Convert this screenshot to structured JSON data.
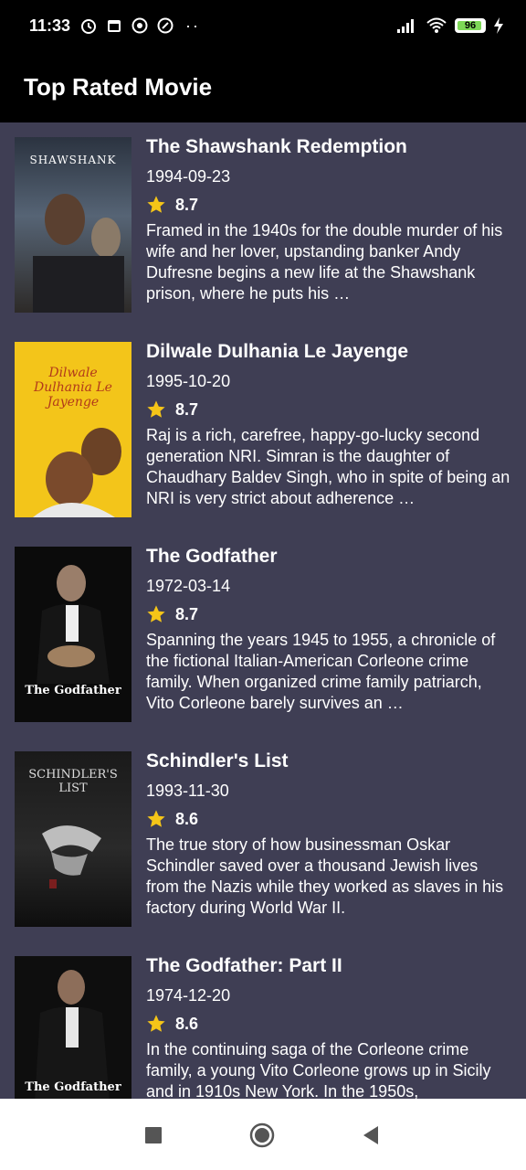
{
  "status_bar": {
    "time": "11:33",
    "battery": "96",
    "icons": [
      "alarm-icon",
      "calendar-icon",
      "whatsapp-icon",
      "sync-icon",
      "more-dots-icon",
      "signal-icon",
      "wifi-icon",
      "battery-icon",
      "charging-icon"
    ]
  },
  "app_bar": {
    "title": "Top Rated Movie"
  },
  "movies": [
    {
      "title": "The Shawshank Redemption",
      "date": "1994-09-23",
      "rating": "8.7",
      "overview": "Framed in the 1940s for the double murder of his wife and her lover, upstanding banker Andy Dufresne begins a new life at the Shawshank prison, where he puts his …",
      "poster_text": "SHAWSHANK",
      "poster_color": "#3a4a5c"
    },
    {
      "title": "Dilwale Dulhania Le Jayenge",
      "date": "1995-10-20",
      "rating": "8.7",
      "overview": "Raj is a rich, carefree, happy-go-lucky second generation NRI. Simran is the daughter of Chaudhary Baldev Singh, who in spite of being an NRI is very strict about adherence …",
      "poster_text": "Dilwale Dulhania Le Jayenge",
      "poster_color": "#f3c51a"
    },
    {
      "title": "The Godfather",
      "date": "1972-03-14",
      "rating": "8.7",
      "overview": "Spanning the years 1945 to 1955, a chronicle of the fictional Italian-American Corleone crime family. When organized crime family patriarch, Vito Corleone barely survives an …",
      "poster_text": "The Godfather",
      "poster_color": "#0b0b0b"
    },
    {
      "title": "Schindler's List",
      "date": "1993-11-30",
      "rating": "8.6",
      "overview": "The true story of how businessman Oskar Schindler saved over a thousand Jewish lives from the Nazis while they worked as slaves in his factory during World War II.",
      "poster_text": "SCHINDLER'S LIST",
      "poster_color": "#141414"
    },
    {
      "title": "The Godfather: Part II",
      "date": "1974-12-20",
      "rating": "8.6",
      "overview": "In the continuing saga of the Corleone crime family, a young Vito Corleone grows up in Sicily and in 1910s New York. In the 1950s,",
      "poster_text": "The Godfather",
      "poster_color": "#0e0e0e"
    }
  ],
  "nav_bar": {
    "icons": [
      "recents-square-icon",
      "home-circle-icon",
      "back-triangle-icon"
    ]
  },
  "colors": {
    "background": "#3f3e54",
    "bar": "#000000",
    "star": "#f5c518"
  }
}
